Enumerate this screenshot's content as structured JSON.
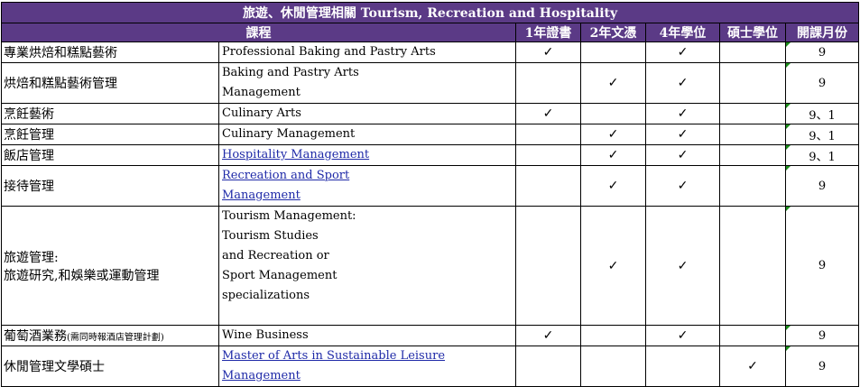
{
  "title": "旅遊、休閒管理相關 Tourism, Recreation and Hospitality",
  "headers": {
    "course": "課程",
    "cert": "1年證書",
    "diploma": "2年文憑",
    "bachelor": "4年學位",
    "master": "碩士學位",
    "intake": "開課月份"
  },
  "rows": [
    {
      "zh": "專業烘焙和糕點藝術",
      "en": [
        "Professional Baking and Pastry Arts"
      ],
      "link": false,
      "cert": "✓",
      "diploma": "",
      "bachelor": "✓",
      "master": "",
      "intake": "9"
    },
    {
      "zh": "烘焙和糕點藝術管理",
      "en": [
        "Baking and Pastry Arts",
        "Management"
      ],
      "link": false,
      "cert": "",
      "diploma": "✓",
      "bachelor": "✓",
      "master": "",
      "intake": "9"
    },
    {
      "zh": "烹飪藝術",
      "en": [
        "Culinary Arts"
      ],
      "link": false,
      "cert": "✓",
      "diploma": "",
      "bachelor": "✓",
      "master": "",
      "intake": "9、1"
    },
    {
      "zh": "烹飪管理",
      "en": [
        "Culinary Management"
      ],
      "link": false,
      "cert": "",
      "diploma": "✓",
      "bachelor": "✓",
      "master": "",
      "intake": "9、1"
    },
    {
      "zh": "飯店管理",
      "en": [
        "Hospitality Management"
      ],
      "link": true,
      "cert": "",
      "diploma": "✓",
      "bachelor": "✓",
      "master": "",
      "intake": "9、1"
    },
    {
      "zh": "接待管理",
      "en": [
        "Recreation and Sport",
        "Management"
      ],
      "link": true,
      "cert": "",
      "diploma": "✓",
      "bachelor": "✓",
      "master": "",
      "intake": "9"
    },
    {
      "zh": "旅遊管理:",
      "zh2": "旅遊研究,和娛樂或運動管理",
      "en": [
        "Tourism Management:",
        "Tourism Studies",
        "and Recreation or",
        "Sport Management",
        "specializations"
      ],
      "link": false,
      "cert": "",
      "diploma": "✓",
      "bachelor": "✓",
      "master": "",
      "intake": "9"
    },
    {
      "zh": "葡萄酒業務",
      "zh_small": "(需同時報酒店管理計劃)",
      "en": [
        "Wine Business"
      ],
      "link": false,
      "cert": "✓",
      "diploma": "",
      "bachelor": "✓",
      "master": "",
      "intake": "9"
    },
    {
      "zh": "休閒管理文學碩士",
      "en": [
        "Master of Arts in Sustainable Leisure Management"
      ],
      "link": true,
      "cert": "",
      "diploma": "",
      "bachelor": "",
      "master": "✓",
      "intake": "9"
    }
  ]
}
